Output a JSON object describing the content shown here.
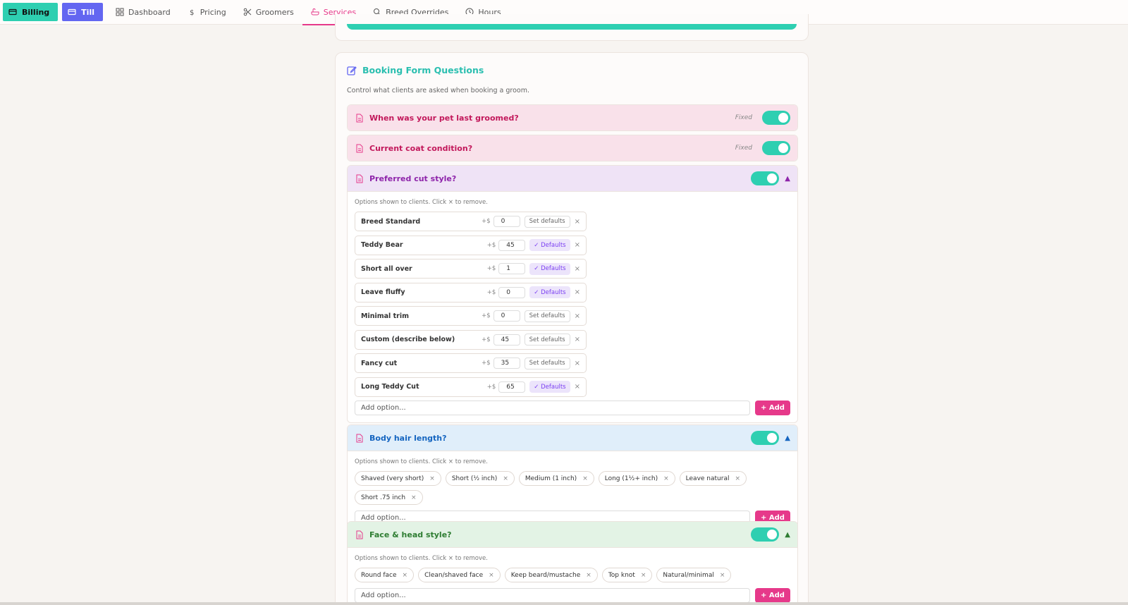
{
  "nav": {
    "billing": "Billing",
    "till": "Till",
    "links": [
      "Dashboard",
      "Pricing",
      "Groomers",
      "Services",
      "Breed Overrides",
      "Hours"
    ]
  },
  "card": {
    "title": "Booking Form Questions",
    "description": "Control what clients are asked when booking a groom."
  },
  "questions": {
    "q1": {
      "title": "When was your pet last groomed?",
      "fixed": "Fixed"
    },
    "q2": {
      "title": "Current coat condition?",
      "fixed": "Fixed"
    },
    "q3": {
      "title": "Preferred cut style?",
      "hint": "Options shown to clients. Click × to remove.",
      "options": [
        {
          "name": "Breed Standard",
          "price": "0",
          "defaults": "Set defaults",
          "state": "set"
        },
        {
          "name": "Teddy Bear",
          "price": "45",
          "defaults": "✓ Defaults",
          "state": "ok"
        },
        {
          "name": "Short all over",
          "price": "1",
          "defaults": "✓ Defaults",
          "state": "ok"
        },
        {
          "name": "Leave fluffy",
          "price": "0",
          "defaults": "✓ Defaults",
          "state": "ok"
        },
        {
          "name": "Minimal trim",
          "price": "0",
          "defaults": "Set defaults",
          "state": "set"
        },
        {
          "name": "Custom (describe below)",
          "price": "45",
          "defaults": "Set defaults",
          "state": "set"
        },
        {
          "name": "Fancy cut",
          "price": "35",
          "defaults": "Set defaults",
          "state": "set"
        },
        {
          "name": "Long Teddy Cut",
          "price": "65",
          "defaults": "✓ Defaults",
          "state": "ok"
        }
      ],
      "plus_label": "+$",
      "add_placeholder": "Add option...",
      "add_label": "+ Add"
    },
    "q4": {
      "title": "Body hair length?",
      "hint": "Options shown to clients. Click × to remove.",
      "chips": [
        "Shaved (very short)",
        "Short (½ inch)",
        "Medium (1 inch)",
        "Long (1½+ inch)",
        "Leave natural",
        "Short .75 inch"
      ],
      "add_placeholder": "Add option...",
      "add_label": "+ Add"
    },
    "q5": {
      "title": "Face & head style?",
      "hint": "Options shown to clients. Click × to remove.",
      "chips": [
        "Round face",
        "Clean/shaved face",
        "Keep beard/mustache",
        "Top knot",
        "Natural/minimal"
      ],
      "add_placeholder": "Add option...",
      "add_label": "+ Add"
    }
  },
  "remove_glyph": "×",
  "colors": {
    "accent": "#2ecfb1",
    "pink": "#e6398a",
    "indigo": "#6366f1"
  }
}
